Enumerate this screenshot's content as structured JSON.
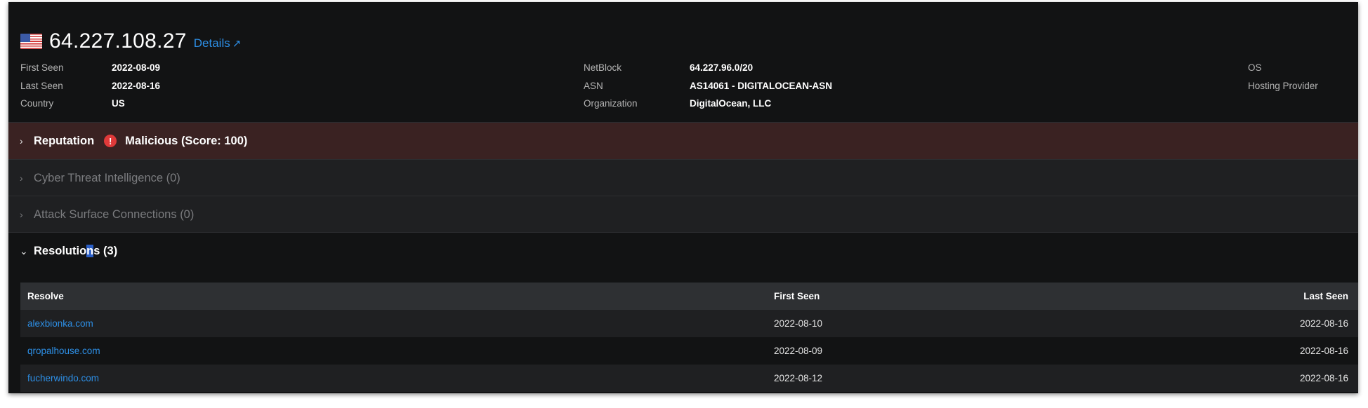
{
  "header": {
    "ip": "64.227.108.27",
    "details_label": "Details",
    "details_icon": "external-arrow-icon",
    "flag": "us-flag-icon"
  },
  "info": {
    "first_seen_label": "First Seen",
    "first_seen": "2022-08-09",
    "last_seen_label": "Last Seen",
    "last_seen": "2022-08-16",
    "country_label": "Country",
    "country": "US",
    "netblock_label": "NetBlock",
    "netblock": "64.227.96.0/20",
    "asn_label": "ASN",
    "asn": "AS14061 - DIGITALOCEAN-ASN",
    "organization_label": "Organization",
    "organization": "DigitalOcean, LLC",
    "os_label": "OS",
    "hosting_label": "Hosting Provider"
  },
  "sections": {
    "reputation": {
      "title": "Reputation",
      "alert_icon": "!",
      "status": "Malicious (Score: 100)",
      "color": "#e03a3a"
    },
    "cti": {
      "title": "Cyber Threat Intelligence (0)"
    },
    "asc": {
      "title": "Attack Surface Connections (0)"
    },
    "resolutions": {
      "title_a": "Resolutio",
      "title_b": "n",
      "title_c": "s (3)"
    }
  },
  "table": {
    "headers": [
      "Resolve",
      "First Seen",
      "Last Seen"
    ],
    "rows": [
      {
        "resolve": "alexbionka.com",
        "first_seen": "2022-08-10",
        "last_seen": "2022-08-16"
      },
      {
        "resolve": "qropalhouse.com",
        "first_seen": "2022-08-09",
        "last_seen": "2022-08-16"
      },
      {
        "resolve": "fucherwindo.com",
        "first_seen": "2022-08-12",
        "last_seen": "2022-08-16"
      }
    ]
  },
  "colors": {
    "link": "#2d8fe6",
    "malicious_bg": "#3a2222",
    "panel_bg": "#121314"
  }
}
